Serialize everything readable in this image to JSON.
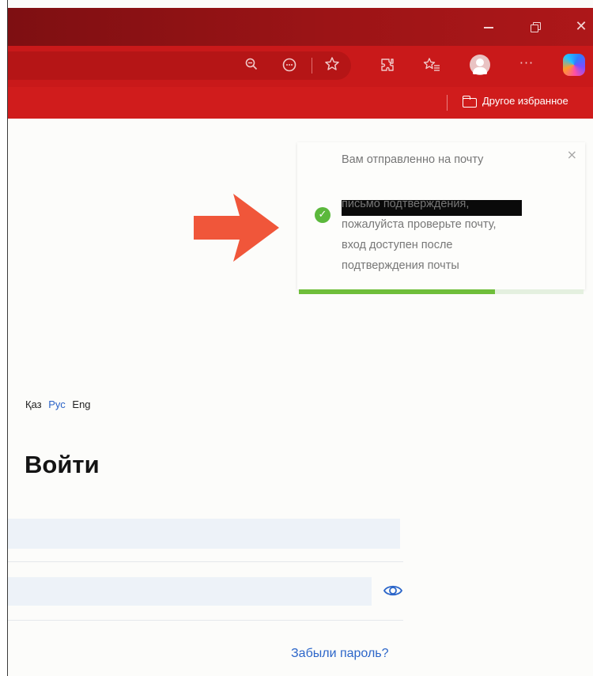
{
  "browser": {
    "window_controls": {
      "minimize": "–",
      "close": "✕"
    },
    "toolbar_icons": [
      "zoom-out-icon",
      "reader-icon",
      "favorite-star-icon",
      "extensions-icon",
      "favorites-icon",
      "profile-icon",
      "more-icon",
      "copilot-icon"
    ],
    "more_glyph": "···",
    "favorites_bar": {
      "other_favorites_label": "Другое избранное"
    },
    "colors": {
      "titlebar": "#8f1214",
      "toolbar": "#c9191a",
      "favbar": "#d01c1c"
    }
  },
  "toast": {
    "close": "×",
    "line1": "Вам отправленно на почту",
    "line3": "письмо подтверждения,",
    "line4": "пожалуйста проверьте почту,",
    "line5": "вход доступен после",
    "line6": "подтверждения почты",
    "progress_fraction": 0.69,
    "colors": {
      "success": "#5bb83c",
      "progress": "#6fbe3a"
    }
  },
  "arrow_color": "#f0563a",
  "language": {
    "kaz": "Қаз",
    "rus": "Рус",
    "eng": "Eng",
    "active": "Рус"
  },
  "login": {
    "title": "Войти",
    "email_value": "",
    "password_value": "",
    "forgot_password": "Забыли пароль?"
  }
}
